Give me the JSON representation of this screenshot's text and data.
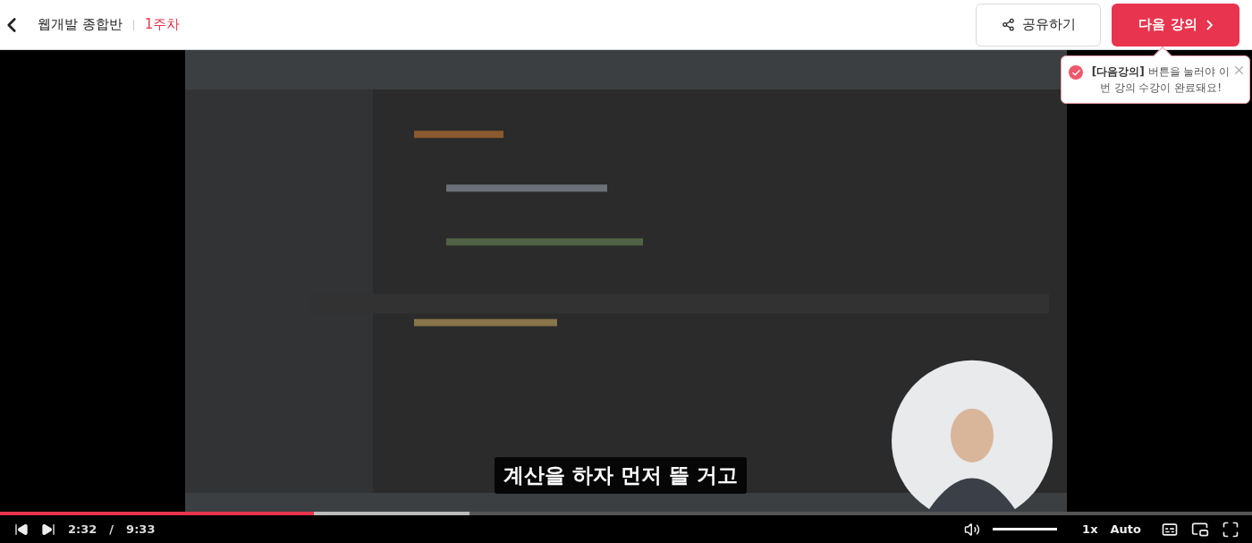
{
  "header": {
    "course_title": "웹개발 종합반",
    "week": "1주차",
    "share_button": "공유하기",
    "next_button": "다음 강의"
  },
  "tooltip": {
    "message": "**[다음강의]** 버튼을 눌러야 이번 강의 수강이 완료돼요!"
  },
  "video": {
    "kind": "picture",
    "subtitle": "계산을 하자 먼저 뜰 거고"
  },
  "player": {
    "progress": {
      "level": 0.251
    },
    "buffered": {
      "level": 0.375
    },
    "current_time": "2:32",
    "separator": "/",
    "duration": "9:33",
    "volume": {
      "level": 1
    },
    "speed": "1x",
    "quality": "Auto"
  }
}
